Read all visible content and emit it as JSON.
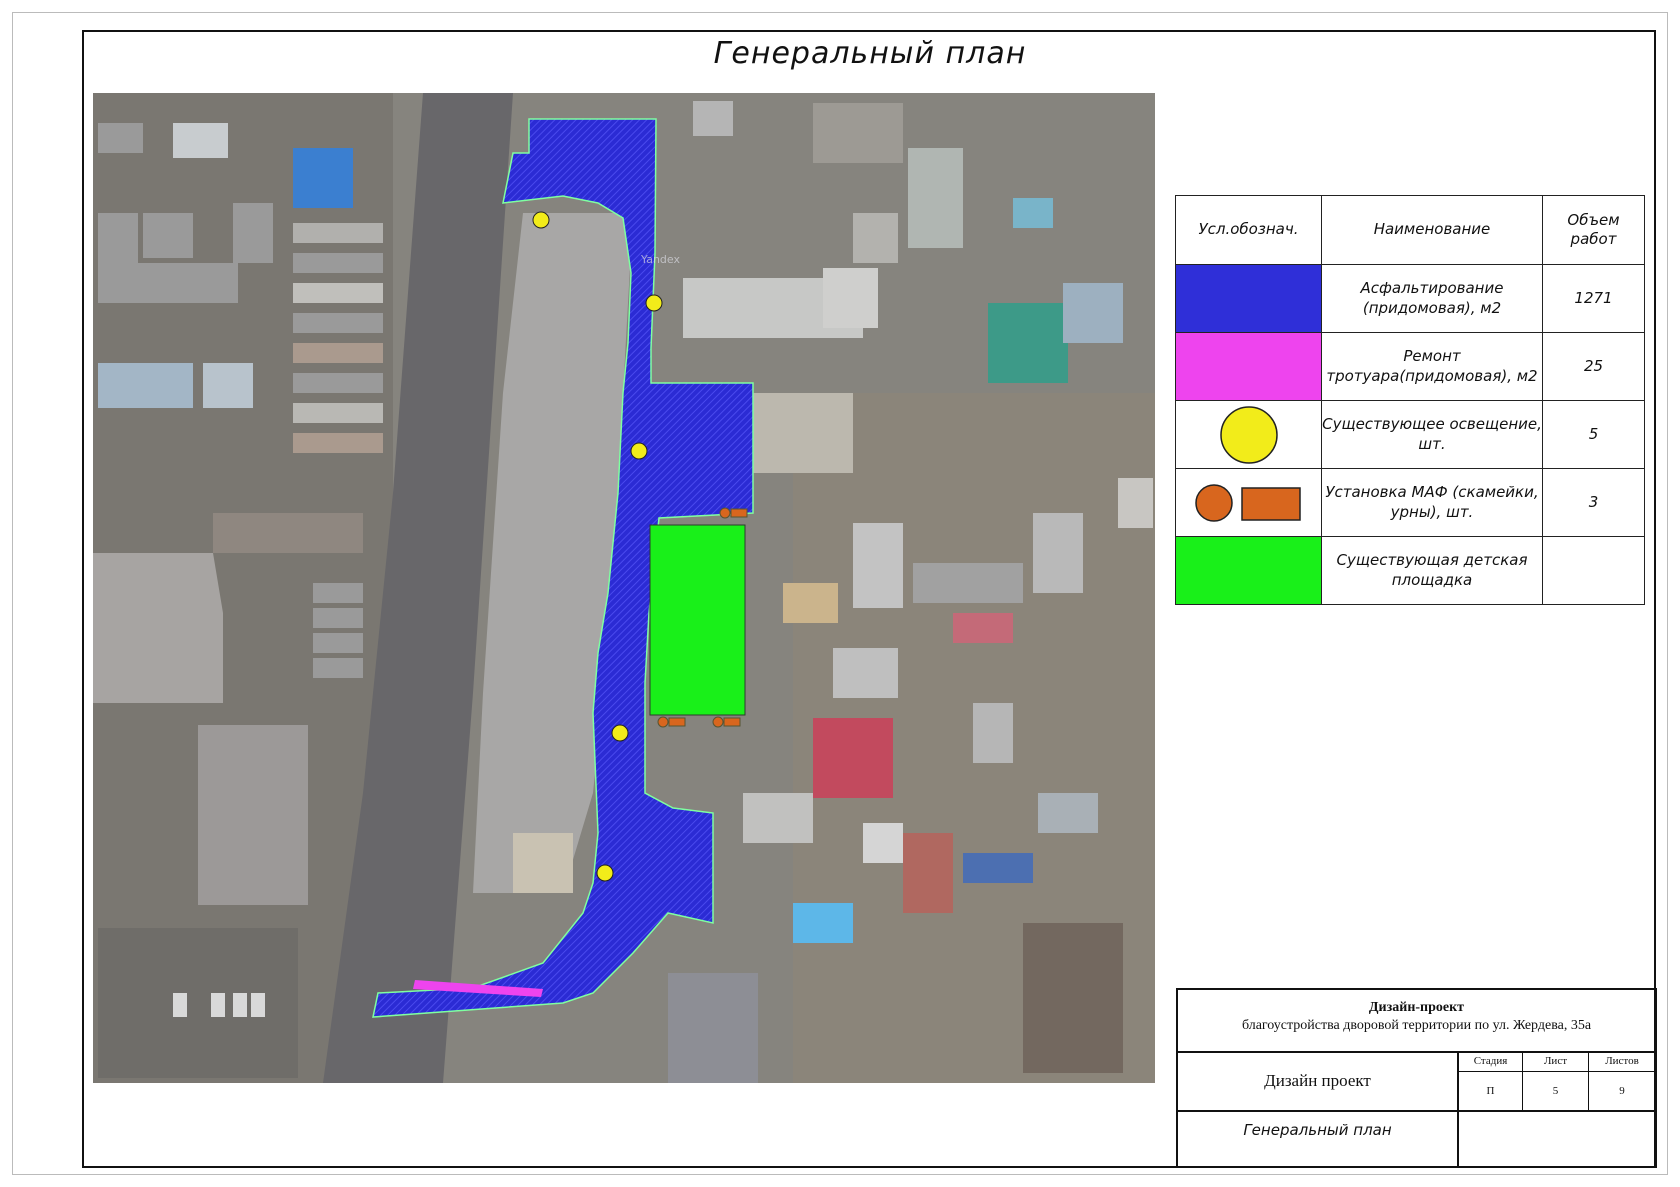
{
  "title": "Генеральный план",
  "legend": {
    "headers": [
      "Усл.обознач.",
      "Наименование",
      "Объем работ"
    ],
    "rows": [
      {
        "symbol": "blue-hatch-swatch",
        "color": "#2f2fd8",
        "name": "Асфальтирование (придомовая), м2",
        "amount": "1271"
      },
      {
        "symbol": "magenta-swatch",
        "color": "#ee44ee",
        "name": "Ремонт тротуара(придомовая), м2",
        "amount": "25"
      },
      {
        "symbol": "yellow-circle",
        "color": "#f2ec1a",
        "name": "Существующее освещение, шт.",
        "amount": "5"
      },
      {
        "symbol": "orange-circle-and-rectangle",
        "color": "#d8661e",
        "name": "Установка МАФ (скамейки, урны), шт.",
        "amount": "3"
      },
      {
        "symbol": "green-swatch",
        "color": "#19f019",
        "name": "Существующая детская площадка",
        "amount": ""
      }
    ]
  },
  "title_block": {
    "project": "Дизайн-проект",
    "description": "благоустройства дворовой территории по ул. Жердева, 35а",
    "doc_type": "Дизайн проект",
    "columns": [
      {
        "label": "Стадия",
        "value": "П"
      },
      {
        "label": "Лист",
        "value": "5"
      },
      {
        "label": "Листов",
        "value": "9"
      }
    ],
    "sheet_name": "Генеральный план"
  },
  "map": {
    "watermark": "Yandex"
  },
  "colors": {
    "asphalt": "#2f2fd8",
    "sidewalk": "#ee44ee",
    "lights": "#f2ec1a",
    "maf": "#d8661e",
    "playground": "#19f019"
  }
}
